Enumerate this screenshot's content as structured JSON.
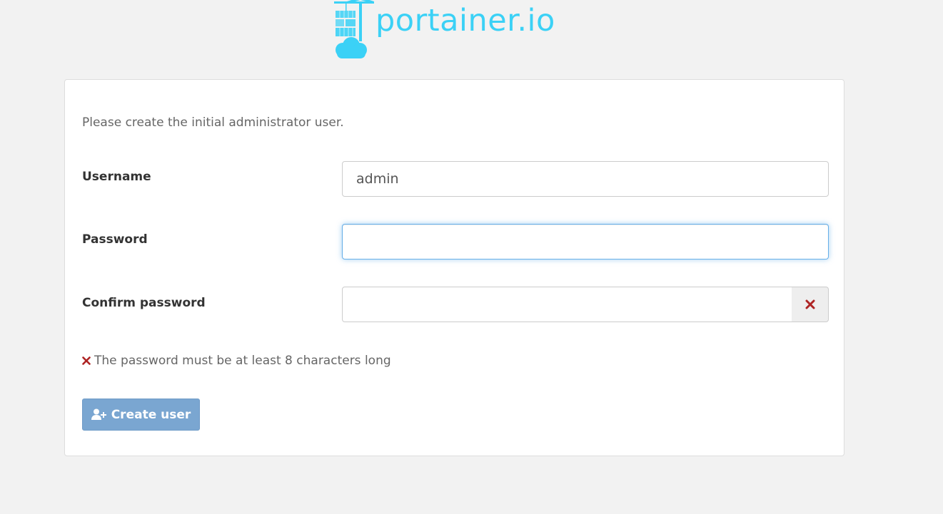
{
  "brand": {
    "logo_text": "portainer.io",
    "color": "#3bd1f6"
  },
  "form": {
    "intro": "Please create the initial administrator user.",
    "username": {
      "label": "Username",
      "value": "admin"
    },
    "password": {
      "label": "Password",
      "value": ""
    },
    "confirm_password": {
      "label": "Confirm password",
      "value": "",
      "status_icon": "times-icon"
    },
    "validation_message": "The password must be at least 8 characters long",
    "submit": {
      "label": "Create user",
      "icon": "user-plus-icon",
      "disabled": true
    }
  },
  "colors": {
    "error": "#ae2424",
    "button_disabled": "#7aa6d1",
    "focus_border": "#66afe9"
  }
}
